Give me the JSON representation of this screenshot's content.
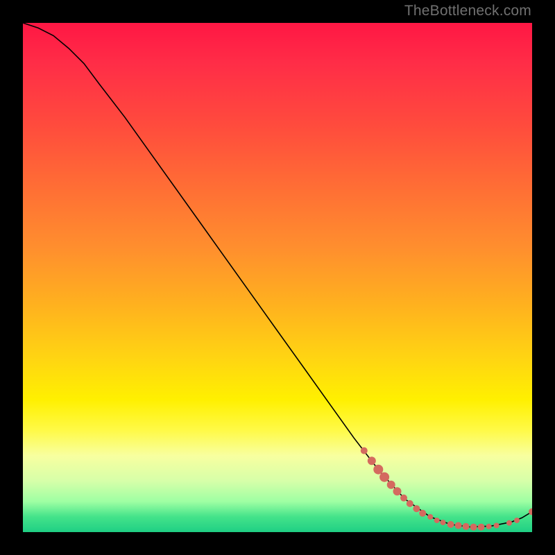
{
  "watermark": "TheBottleneck.com",
  "colors": {
    "gradient_top": "#ff1744",
    "gradient_mid": "#fff000",
    "gradient_bottom": "#1fcf84",
    "curve": "#000000",
    "dots": "#d46a5f",
    "page_bg": "#000000"
  },
  "chart_data": {
    "type": "line",
    "title": "",
    "xlabel": "",
    "ylabel": "",
    "xlim": [
      0,
      100
    ],
    "ylim": [
      0,
      100
    ],
    "grid": false,
    "legend": false,
    "curve": [
      {
        "x": 0,
        "y": 100.0
      },
      {
        "x": 3,
        "y": 99.0
      },
      {
        "x": 6,
        "y": 97.5
      },
      {
        "x": 9,
        "y": 95.0
      },
      {
        "x": 12,
        "y": 92.0
      },
      {
        "x": 15,
        "y": 88.0
      },
      {
        "x": 20,
        "y": 81.5
      },
      {
        "x": 25,
        "y": 74.5
      },
      {
        "x": 30,
        "y": 67.5
      },
      {
        "x": 35,
        "y": 60.5
      },
      {
        "x": 40,
        "y": 53.5
      },
      {
        "x": 45,
        "y": 46.5
      },
      {
        "x": 50,
        "y": 39.5
      },
      {
        "x": 55,
        "y": 32.5
      },
      {
        "x": 60,
        "y": 25.5
      },
      {
        "x": 65,
        "y": 18.5
      },
      {
        "x": 70,
        "y": 12.0
      },
      {
        "x": 75,
        "y": 6.5
      },
      {
        "x": 80,
        "y": 3.0
      },
      {
        "x": 84,
        "y": 1.5
      },
      {
        "x": 88,
        "y": 1.0
      },
      {
        "x": 92,
        "y": 1.2
      },
      {
        "x": 96,
        "y": 2.0
      },
      {
        "x": 98,
        "y": 2.8
      },
      {
        "x": 100,
        "y": 4.0
      }
    ],
    "points_cluster_descending": [
      {
        "x": 67.0,
        "y": 16.0,
        "r": 5
      },
      {
        "x": 68.5,
        "y": 14.0,
        "r": 6
      },
      {
        "x": 69.8,
        "y": 12.3,
        "r": 7
      },
      {
        "x": 71.0,
        "y": 10.8,
        "r": 7
      },
      {
        "x": 72.3,
        "y": 9.3,
        "r": 6
      },
      {
        "x": 73.5,
        "y": 8.0,
        "r": 6
      },
      {
        "x": 74.8,
        "y": 6.7,
        "r": 5
      },
      {
        "x": 76.0,
        "y": 5.6,
        "r": 5
      },
      {
        "x": 77.3,
        "y": 4.6,
        "r": 5
      },
      {
        "x": 78.5,
        "y": 3.7,
        "r": 5
      }
    ],
    "points_cluster_bottom": [
      {
        "x": 80.0,
        "y": 3.0,
        "r": 4
      },
      {
        "x": 81.3,
        "y": 2.3,
        "r": 4
      },
      {
        "x": 82.5,
        "y": 1.9,
        "r": 4
      },
      {
        "x": 84.0,
        "y": 1.5,
        "r": 5
      },
      {
        "x": 85.5,
        "y": 1.3,
        "r": 5
      },
      {
        "x": 87.0,
        "y": 1.1,
        "r": 5
      },
      {
        "x": 88.5,
        "y": 1.0,
        "r": 5
      },
      {
        "x": 90.0,
        "y": 1.0,
        "r": 5
      },
      {
        "x": 91.5,
        "y": 1.1,
        "r": 4
      },
      {
        "x": 93.0,
        "y": 1.3,
        "r": 4
      },
      {
        "x": 95.5,
        "y": 1.8,
        "r": 4
      },
      {
        "x": 97.0,
        "y": 2.3,
        "r": 4
      },
      {
        "x": 100.0,
        "y": 4.0,
        "r": 5
      }
    ]
  }
}
